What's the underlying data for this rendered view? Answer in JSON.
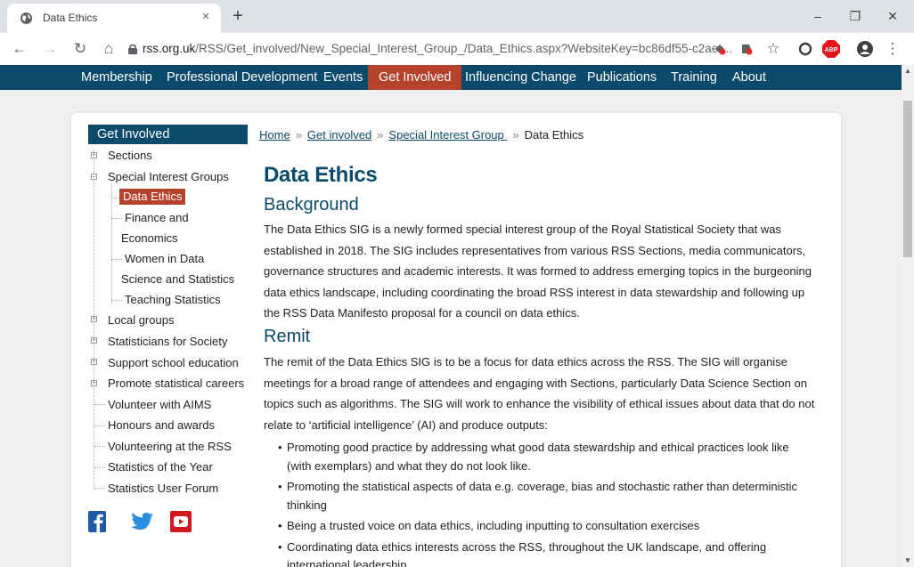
{
  "browser": {
    "tab_title": "Data Ethics",
    "tab_close": "×",
    "new_tab": "+",
    "url_host": "rss.org.uk",
    "url_path": "/RSS/Get_involved/New_Special_Interest_Group_/Data_Ethics.aspx?WebsiteKey=bc86df55-c2ae-...",
    "window_buttons": [
      "–",
      "❐",
      "✕"
    ],
    "nav_icons": [
      "back-icon",
      "forward-icon",
      "reload-icon",
      "home-icon"
    ],
    "extension_icons": [
      "extension-icon",
      "extension-icon",
      "star-icon",
      "opera-icon",
      "adblock-icon",
      "profile-icon",
      "menu-icon"
    ]
  },
  "site_nav": {
    "items": [
      "Membership",
      "Professional Development",
      "Events",
      "Get Involved",
      "Influencing Change",
      "Publications",
      "Training",
      "About"
    ],
    "active": "Get Involved"
  },
  "sidebar": {
    "title": "Get Involved",
    "items": [
      "Sections",
      "Special Interest Groups",
      "Data Ethics",
      "Finance and",
      "Economics",
      "Women in Data",
      "Science and Statistics",
      "Teaching Statistics",
      "Local groups",
      "Statisticians for Society",
      "Support school education",
      "Promote statistical careers",
      "Volunteer with AIMS",
      "Honours and awards",
      "Volunteering at the RSS",
      "Statistics of the Year",
      "Statistics User Forum"
    ],
    "social": [
      "facebook-icon",
      "twitter-icon",
      "youtube-icon"
    ]
  },
  "breadcrumb": {
    "home": "Home",
    "get_involved": "Get involved",
    "sig": "Special Interest Group ",
    "current": "Data Ethics",
    "sep": "»"
  },
  "content": {
    "title": "Data Ethics",
    "background_heading": "Background",
    "background_text": "The Data Ethics SIG is a newly formed special interest group of the Royal Statistical Society that was established in 2018. The SIG includes representatives from various RSS Sections, media communicators, governance structures and academic interests. It was formed to address emerging topics in the burgeoning data ethics landscape, including coordinating the broad RSS interest in data stewardship and following up the RSS Data Manifesto proposal for a council on data ethics.",
    "remit_heading": "Remit",
    "remit_text": "The remit of the Data Ethics SIG is to be a focus for data ethics across the RSS. The SIG will organise meetings for a broad range of attendees and engaging with Sections, particularly Data Science Section on topics such as algorithms. The SIG will work to enhance the visibility of ethical issues about data that do not relate to ‘artificial intelligence’ (AI) and produce outputs:",
    "bullets": [
      "Promoting good practice by addressing what good data stewardship and ethical practices look like (with exemplars) and what they do not look like.",
      "Promoting the statistical aspects of data e.g. coverage, bias and stochastic rather than deterministic thinking",
      "Being a trusted voice on data ethics, including inputting to consultation exercises",
      "Coordinating data ethics interests across the RSS, throughout the UK landscape, and offering international leadership"
    ]
  },
  "colors": {
    "nav_blue": "#0b4a6b",
    "active_red": "#b5432c"
  }
}
